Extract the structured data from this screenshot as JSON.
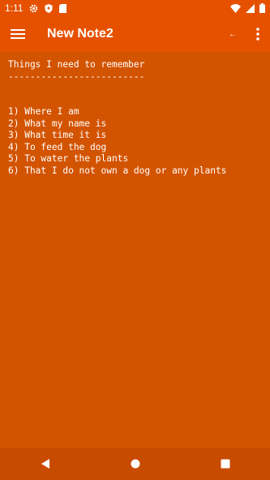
{
  "status_bar": {
    "time": "1:11",
    "icons": [
      "gear-icon",
      "shield-icon",
      "sd-card-icon",
      "wifi-icon",
      "cellular-icon",
      "battery-icon"
    ]
  },
  "app_bar": {
    "title": "New Note2",
    "icons": [
      "hamburger-menu-icon",
      "undo-arrow-icon",
      "overflow-menu-icon"
    ],
    "undo_glyph": "←"
  },
  "note": {
    "lines": [
      "Things I need to remember",
      "-------------------------",
      "",
      "",
      "1) Where I am",
      "2) What my name is",
      "3) What time it is",
      "4) To feed the dog",
      "5) To water the plants",
      "6) That I do not own a dog or any plants"
    ]
  },
  "nav_bar": {
    "icons": [
      "back-icon",
      "home-icon",
      "recents-icon"
    ]
  },
  "colors": {
    "app_bar": "#e65100",
    "background": "#d35400",
    "nav_bar": "#c84b00",
    "text": "#ffffff"
  }
}
